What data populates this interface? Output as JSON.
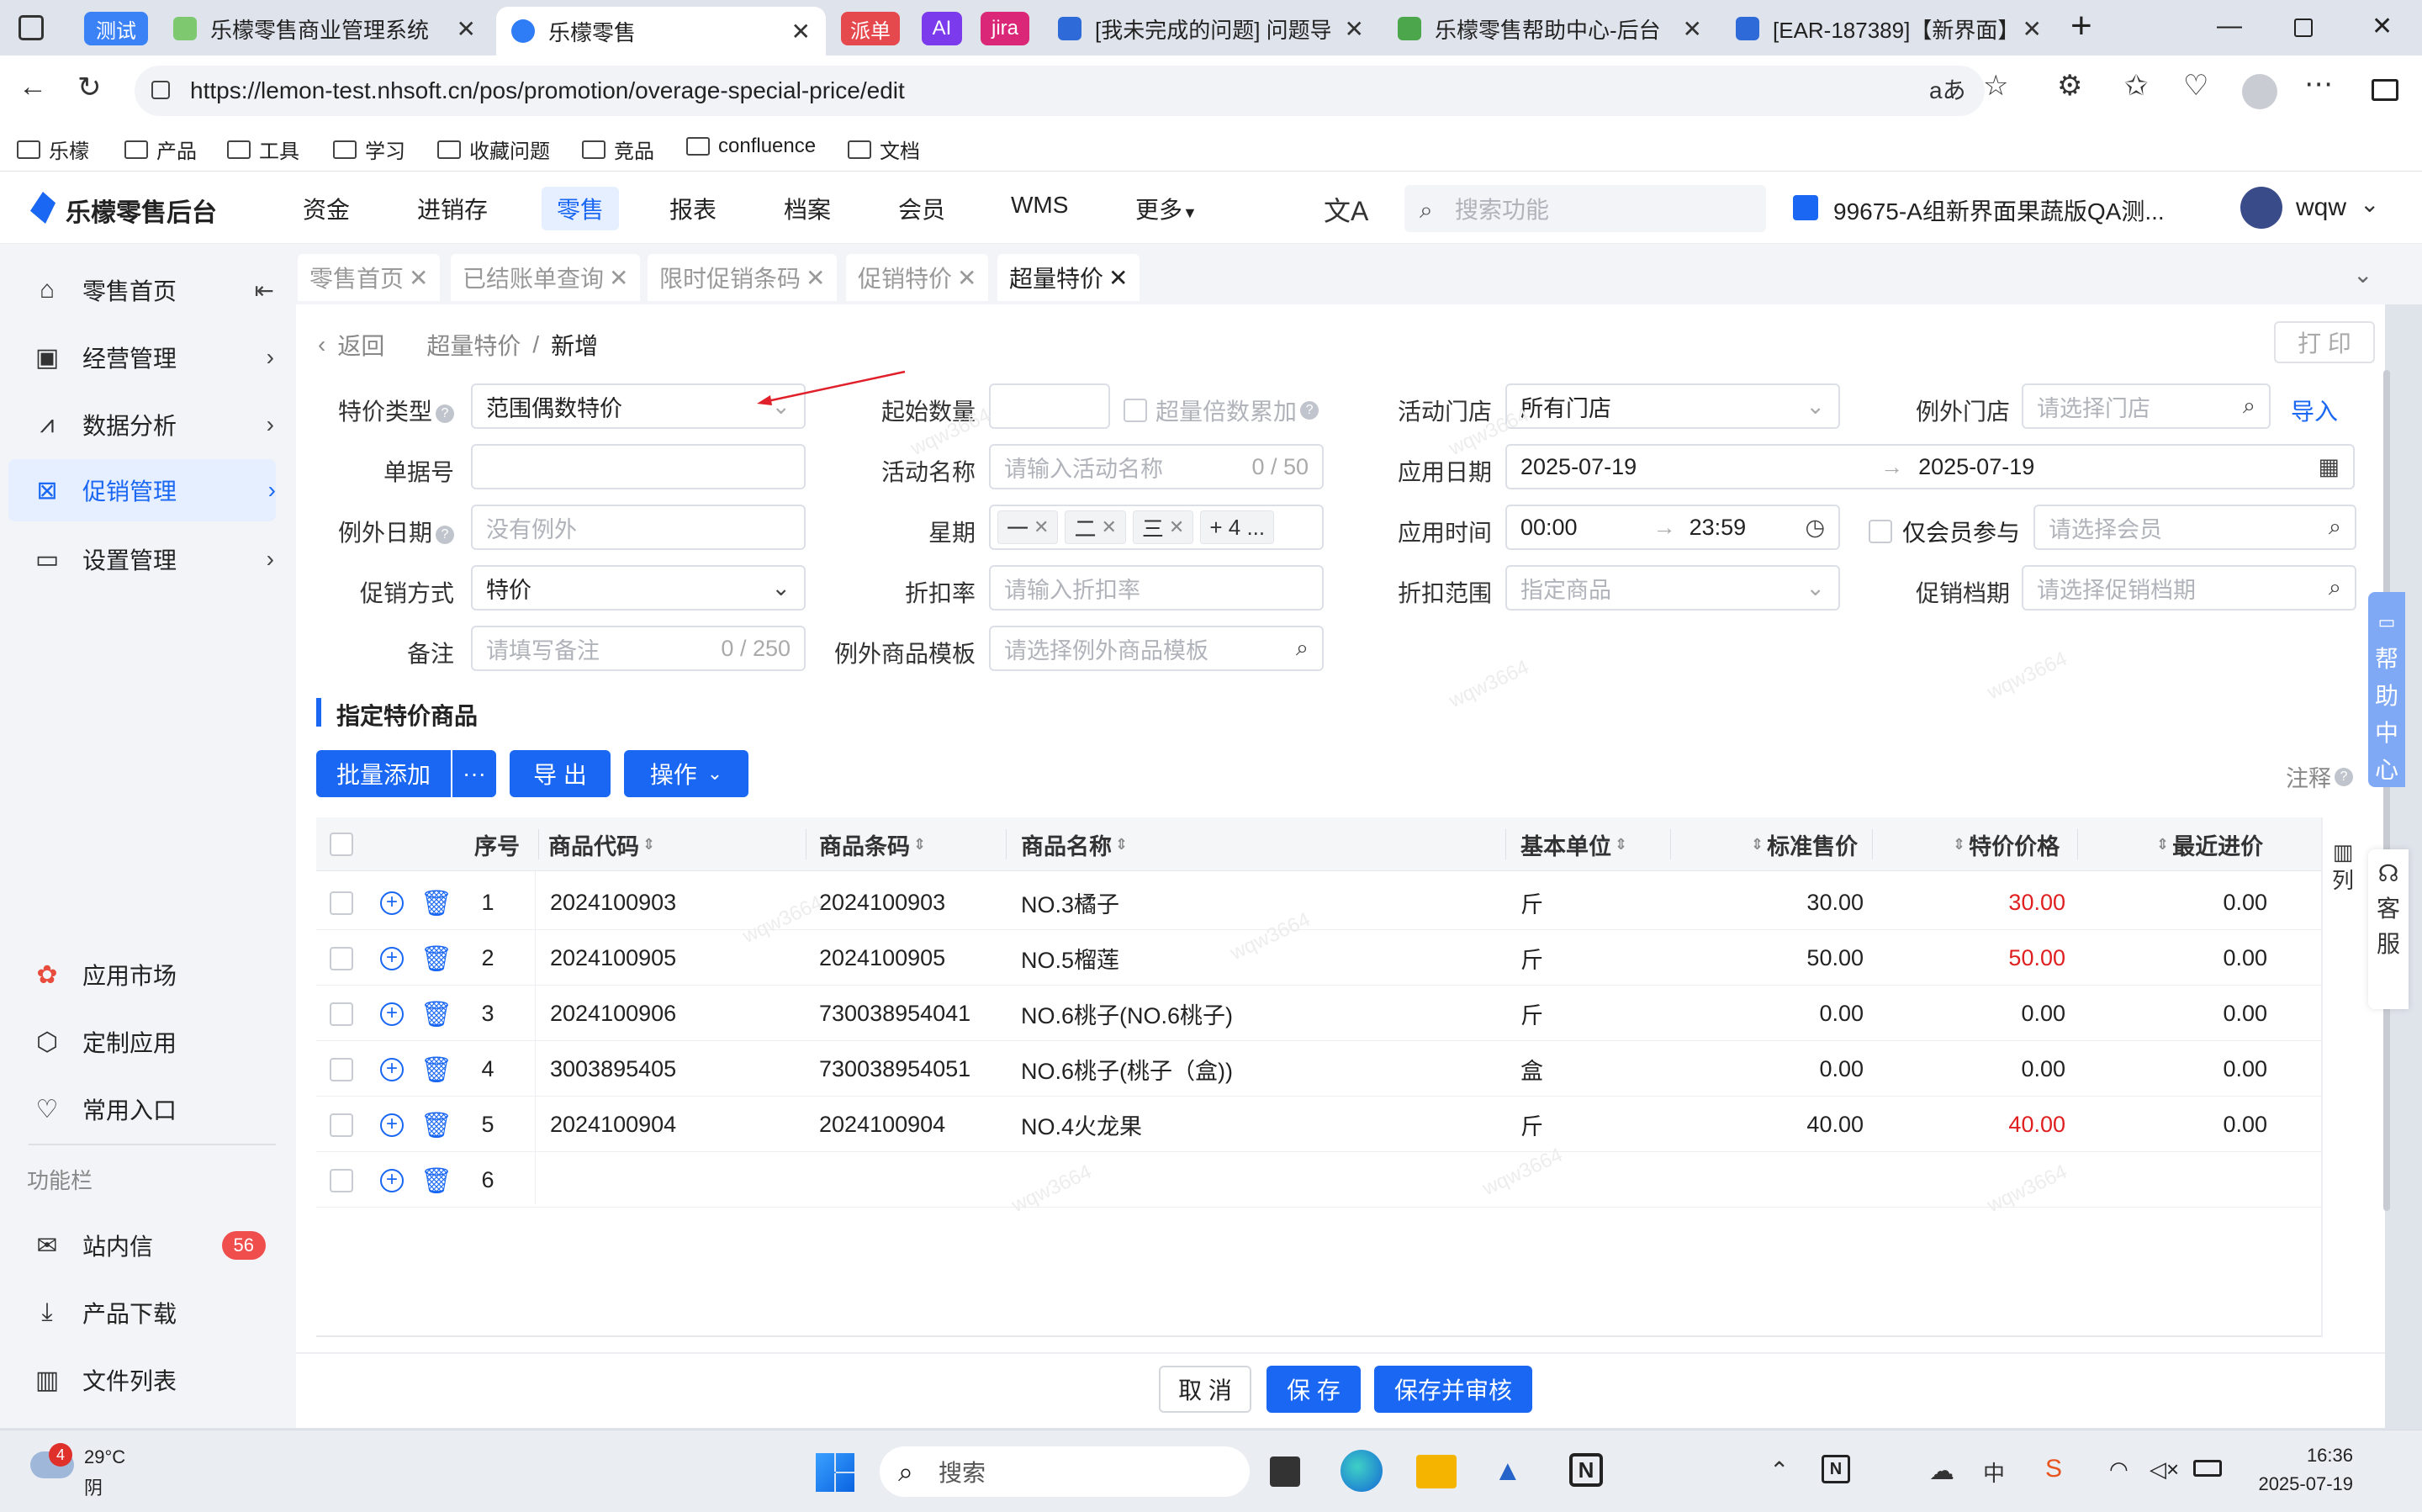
{
  "browser": {
    "tabs": [
      {
        "label": "测试",
        "type": "pill",
        "color": "#3b82f6"
      },
      {
        "label": "乐檬零售商业管理系统"
      },
      {
        "label": "乐檬零售",
        "active": true
      },
      {
        "label": "派单",
        "type": "pill",
        "color": "#e5484d"
      },
      {
        "label": "AI",
        "type": "pill",
        "color": "#7c3aed"
      },
      {
        "label": "jira",
        "type": "pill",
        "color": "#db2777"
      },
      {
        "label": "[我未完成的问题] 问题导航"
      },
      {
        "label": "乐檬零售帮助中心-后台"
      },
      {
        "label": "[EAR-187389]【新界面】"
      }
    ],
    "url": "https://lemon-test.nhsoft.cn/pos/promotion/overage-special-price/edit",
    "bookmarks": [
      "乐檬",
      "产品",
      "工具",
      "学习",
      "收藏问题",
      "竞品",
      "confluence",
      "文档"
    ]
  },
  "app": {
    "logo": "乐檬零售后台",
    "nav": [
      "资金",
      "进销存",
      "零售",
      "报表",
      "档案",
      "会员",
      "WMS",
      "更多"
    ],
    "active_nav": "零售",
    "search_placeholder": "搜索功能",
    "store": "99675-A组新界面果蔬版QA测...",
    "user": "wqw"
  },
  "sidebar": {
    "items": [
      {
        "label": "零售首页",
        "icon": "home-icon"
      },
      {
        "label": "经营管理",
        "icon": "chart-board-icon"
      },
      {
        "label": "数据分析",
        "icon": "analytics-icon"
      },
      {
        "label": "促销管理",
        "icon": "promotion-icon",
        "active": true
      },
      {
        "label": "设置管理",
        "icon": "settings-folder-icon"
      }
    ],
    "bottom": [
      {
        "label": "应用市场",
        "icon": "app-market-icon"
      },
      {
        "label": "定制应用",
        "icon": "custom-app-icon"
      },
      {
        "label": "常用入口",
        "icon": "heart-icon"
      }
    ],
    "section_title": "功能栏",
    "func": [
      {
        "label": "站内信",
        "icon": "mail-icon",
        "badge": "56"
      },
      {
        "label": "产品下载",
        "icon": "download-icon"
      },
      {
        "label": "文件列表",
        "icon": "file-list-icon"
      }
    ]
  },
  "page_tabs": [
    "零售首页",
    "已结账单查询",
    "限时促销条码",
    "促销特价",
    "超量特价"
  ],
  "breadcrumb": {
    "back": "返回",
    "parent": "超量特价",
    "current": "新增"
  },
  "print_label": "打 印",
  "form": {
    "special_type_label": "特价类型",
    "special_type_value": "范围偶数特价",
    "start_qty_label": "起始数量",
    "overage_multiple_label": "超量倍数累加",
    "store_label": "活动门店",
    "store_value": "所有门店",
    "except_store_label": "例外门店",
    "except_store_ph": "请选择门店",
    "import_label": "导入",
    "doc_no_label": "单据号",
    "activity_name_label": "活动名称",
    "activity_name_ph": "请输入活动名称",
    "activity_name_count": "0 / 50",
    "apply_date_label": "应用日期",
    "date_start": "2025-07-19",
    "date_end": "2025-07-19",
    "except_date_label": "例外日期",
    "except_date_ph": "没有例外",
    "week_label": "星期",
    "week_tags": [
      "一",
      "二",
      "三"
    ],
    "week_more": "+ 4 ...",
    "apply_time_label": "应用时间",
    "time_start": "00:00",
    "time_end": "23:59",
    "member_only_label": "仅会员参与",
    "member_ph": "请选择会员",
    "promo_mode_label": "促销方式",
    "promo_mode_value": "特价",
    "discount_rate_label": "折扣率",
    "discount_rate_ph": "请输入折扣率",
    "discount_range_label": "折扣范围",
    "discount_range_ph": "指定商品",
    "promo_level_label": "促销档期",
    "promo_level_ph": "请选择促销档期",
    "remark_label": "备注",
    "remark_ph": "请填写备注",
    "remark_count": "0 / 250",
    "except_tpl_label": "例外商品模板",
    "except_tpl_ph": "请选择例外商品模板"
  },
  "section_title": "指定特价商品",
  "actions": {
    "batch_add": "批量添加",
    "more": "···",
    "export": "导 出",
    "operate": "操作",
    "note": "注释"
  },
  "table": {
    "headers": [
      "序号",
      "商品代码",
      "商品条码",
      "商品名称",
      "基本单位",
      "标准售价",
      "特价价格",
      "最近进价"
    ],
    "col_setting": "列",
    "rows": [
      {
        "no": "1",
        "code": "2024100903",
        "barcode": "2024100903",
        "name": "NO.3橘子",
        "unit": "斤",
        "std": "30.00",
        "special": "30.00",
        "recent": "0.00",
        "special_red": true
      },
      {
        "no": "2",
        "code": "2024100905",
        "barcode": "2024100905",
        "name": "NO.5榴莲",
        "unit": "斤",
        "std": "50.00",
        "special": "50.00",
        "recent": "0.00",
        "special_red": true
      },
      {
        "no": "3",
        "code": "2024100906",
        "barcode": "730038954041",
        "name": "NO.6桃子(NO.6桃子)",
        "unit": "斤",
        "std": "0.00",
        "special": "0.00",
        "recent": "0.00",
        "special_red": false
      },
      {
        "no": "4",
        "code": "3003895405",
        "barcode": "730038954051",
        "name": "NO.6桃子(桃子（盒))",
        "unit": "盒",
        "std": "0.00",
        "special": "0.00",
        "recent": "0.00",
        "special_red": false
      },
      {
        "no": "5",
        "code": "2024100904",
        "barcode": "2024100904",
        "name": "NO.4火龙果",
        "unit": "斤",
        "std": "40.00",
        "special": "40.00",
        "recent": "0.00",
        "special_red": true
      },
      {
        "no": "6",
        "code": "",
        "barcode": "",
        "name": "",
        "unit": "",
        "std": "",
        "special": "",
        "recent": "",
        "special_red": false
      }
    ]
  },
  "footer": {
    "cancel": "取 消",
    "save": "保 存",
    "save_audit": "保存并审核"
  },
  "float": {
    "help": "帮助中心",
    "service": "客服"
  },
  "watermark": "wqw3664",
  "taskbar": {
    "weather_temp": "29°C",
    "weather_desc": "阴",
    "weather_badge": "4",
    "search": "搜索",
    "time": "16:36",
    "date": "2025-07-19"
  },
  "colors": {
    "primary": "#1967f2",
    "danger": "#e02020"
  }
}
